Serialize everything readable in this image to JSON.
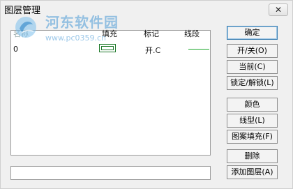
{
  "window": {
    "title": "图层管理",
    "close_label": "✕"
  },
  "watermark": {
    "name": "河东软件园",
    "url": "www.pc0359.cn"
  },
  "list": {
    "columns": {
      "name": "名称",
      "fill": "填充",
      "mark": "标记",
      "line": "线段"
    },
    "rows": [
      {
        "name": "0",
        "mark": "开.C"
      }
    ]
  },
  "name_input": {
    "value": ""
  },
  "buttons": {
    "ok": "确定",
    "on_off": "开/关(O)",
    "current": "当前(C)",
    "lock_unlock": "锁定/解锁(L)",
    "color": "颜色",
    "linetype": "线型(L)",
    "hatch_fill": "图案填充(F)",
    "delete": "删除",
    "add_layer": "添加图层(A)"
  },
  "colors": {
    "fill_swatch": "#1e7a2a",
    "line_sample": "#1aa82a",
    "watermark": "#4a9ad6"
  }
}
